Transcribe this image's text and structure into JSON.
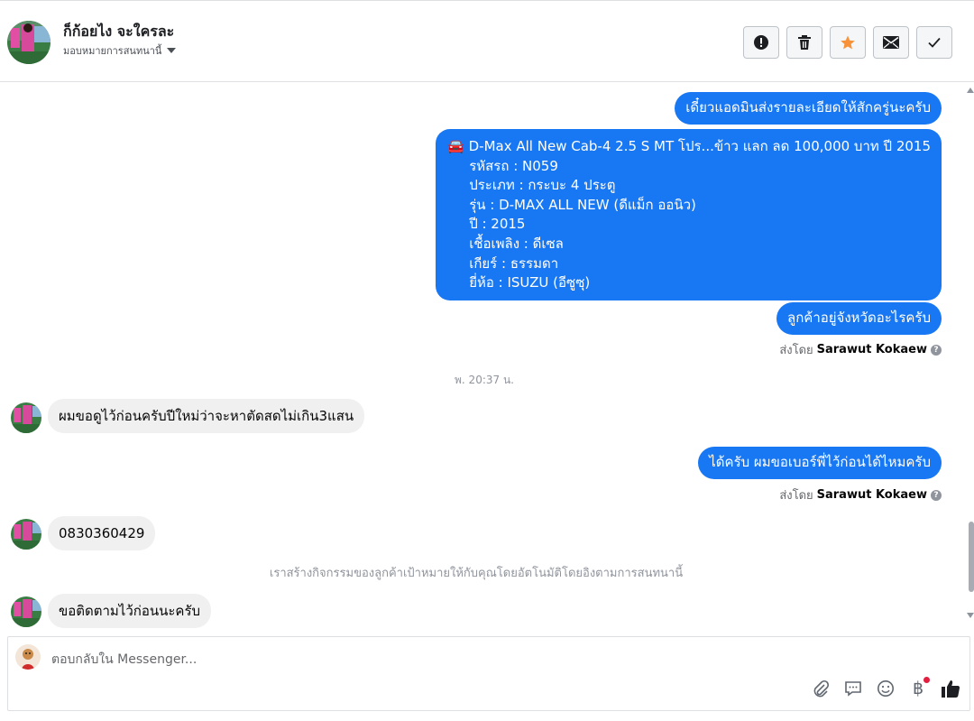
{
  "contact": {
    "name": "ก็ก้อยไง จะใครละ",
    "assign_label": "มอบหมายการสนทนานี้"
  },
  "header_actions": [
    "spam-icon",
    "trash-icon",
    "star-icon",
    "envelope-icon",
    "check-icon"
  ],
  "colors": {
    "accent": "#1877f2",
    "star": "#f7923b",
    "incoming_bubble": "#f0f0f0"
  },
  "messages": {
    "out1": "เดี๋ยวแอดมินส่งรายละเอียดให้สักครู่นะครับ",
    "car_title": "🚘 D-Max All New Cab-4 2.5 S MT โปร...ข้าว แลก ลด 100,000 บาท ปี 2015",
    "car_lines": [
      "รหัสรถ : N059",
      "ประเภท : กระบะ 4 ประตู",
      "รุ่น : D-MAX ALL NEW (ดีแม็ก ออนิว)",
      "ปี : 2015",
      "เชื้อเพลิง : ดีเซล",
      "เกียร์ : ธรรมดา",
      "ยี่ห้อ : ISUZU (อีซูซุ)"
    ],
    "out2": "ลูกค้าอยู่จังหวัดอะไรครับ",
    "sent_by_label": "ส่งโดย",
    "sender": "Sarawut Kokaew",
    "timestamp": "พ. 20:37 น.",
    "in1": "ผมขอดูไว้ก่อนครับปีใหม่ว่าจะหาตัดสดไม่เกิน3แสน",
    "out3": "ได้ครับ ผมขอเบอร์พี่ไว้ก่อนได้ไหมครับ",
    "in2": "0830360429",
    "system_note": "เราสร้างกิจกรรมของลูกค้าเป้าหมายให้กับคุณโดยอัตโนมัติโดยอิงตามการสนทนานี้",
    "in3": "ขอติดตามไว้ก่อนนะครับ"
  },
  "composer": {
    "placeholder": "ตอบกลับใน Messenger...",
    "tools": [
      "attachment-icon",
      "saved-replies-icon",
      "emoji-icon",
      "payment-icon",
      "like-icon"
    ]
  }
}
